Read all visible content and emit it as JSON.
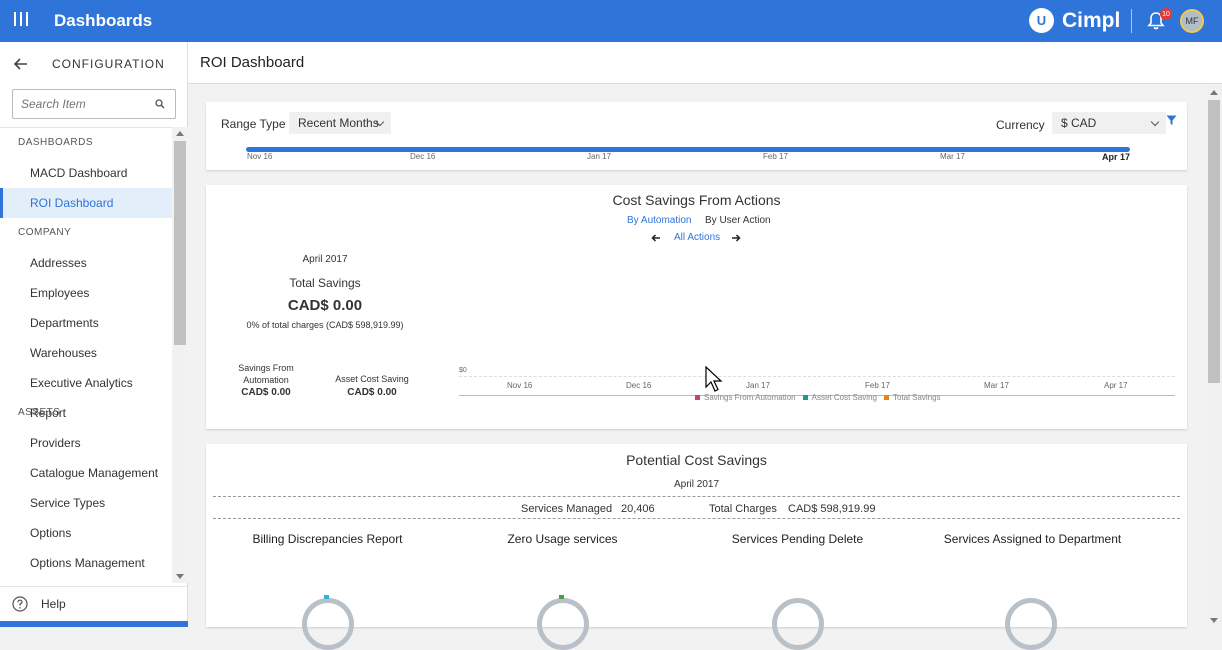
{
  "topbar": {
    "title": "Dashboards",
    "brand_letter": "U",
    "brand_name": "Cimpl",
    "notification_count": "10",
    "avatar_initials": "MF",
    "accent_color": "#2f74d8"
  },
  "sidebar": {
    "header": "CONFIGURATION",
    "search_placeholder": "Search Item",
    "sections": [
      {
        "label": "DASHBOARDS",
        "items": [
          "MACD Dashboard",
          "ROI Dashboard"
        ]
      },
      {
        "label": "COMPANY",
        "items": [
          "Addresses",
          "Employees",
          "Departments",
          "Warehouses",
          "Executive Analytics Report"
        ]
      },
      {
        "label": "ASSETS",
        "items": [
          "Providers",
          "Catalogue Management",
          "Service Types",
          "Options",
          "Options Management"
        ]
      }
    ],
    "active_item": "ROI Dashboard",
    "help_label": "Help"
  },
  "page": {
    "title": "ROI Dashboard"
  },
  "filters": {
    "range_type_label": "Range Type",
    "range_type_value": "Recent Months",
    "currency_label": "Currency",
    "currency_value": "$ CAD",
    "range_ticks": [
      "Nov 16",
      "Dec 16",
      "Jan 17",
      "Feb 17",
      "Mar 17",
      "Apr 17"
    ],
    "selected_tick": "Apr 17"
  },
  "cost_savings": {
    "title": "Cost Savings From Actions",
    "tab_automation": "By Automation",
    "tab_user_action": "By User Action",
    "nav_label": "All Actions",
    "period": "April 2017",
    "total_label": "Total Savings",
    "total_value": "CAD$ 0.00",
    "total_note": "0% of total charges (CAD$ 598,919.99)",
    "automation_label_line1": "Savings From",
    "automation_label_line2": "Automation",
    "automation_value": "CAD$ 0.00",
    "asset_label": "Asset Cost Saving",
    "asset_value": "CAD$ 0.00"
  },
  "chart_data": {
    "type": "line",
    "categories": [
      "Nov 16",
      "Dec 16",
      "Jan 17",
      "Feb 17",
      "Mar 17",
      "Apr 17"
    ],
    "series": [
      {
        "name": "Savings From Automation",
        "color": "#c2466b",
        "values": [
          0,
          0,
          0,
          0,
          0,
          0
        ]
      },
      {
        "name": "Asset Cost Saving",
        "color": "#1a9c94",
        "values": [
          0,
          0,
          0,
          0,
          0,
          0
        ]
      },
      {
        "name": "Total Savings",
        "color": "#e8821e",
        "values": [
          0,
          0,
          0,
          0,
          0,
          0
        ]
      }
    ],
    "y_tick_labels": [
      "$0"
    ],
    "legend_position": "bottom"
  },
  "potential": {
    "title": "Potential Cost Savings",
    "period": "April 2017",
    "services_managed_label": "Services Managed",
    "services_managed_value": "20,406",
    "total_charges_label": "Total Charges",
    "total_charges_value": "CAD$ 598,919.99",
    "columns": [
      {
        "label": "Billing Discrepancies Report",
        "mark_color": "#29b6d8"
      },
      {
        "label": "Zero Usage services",
        "mark_color": "#43a047"
      },
      {
        "label": "Services Pending Delete",
        "mark_color": ""
      },
      {
        "label": "Services Assigned to Department",
        "mark_color": ""
      }
    ]
  }
}
